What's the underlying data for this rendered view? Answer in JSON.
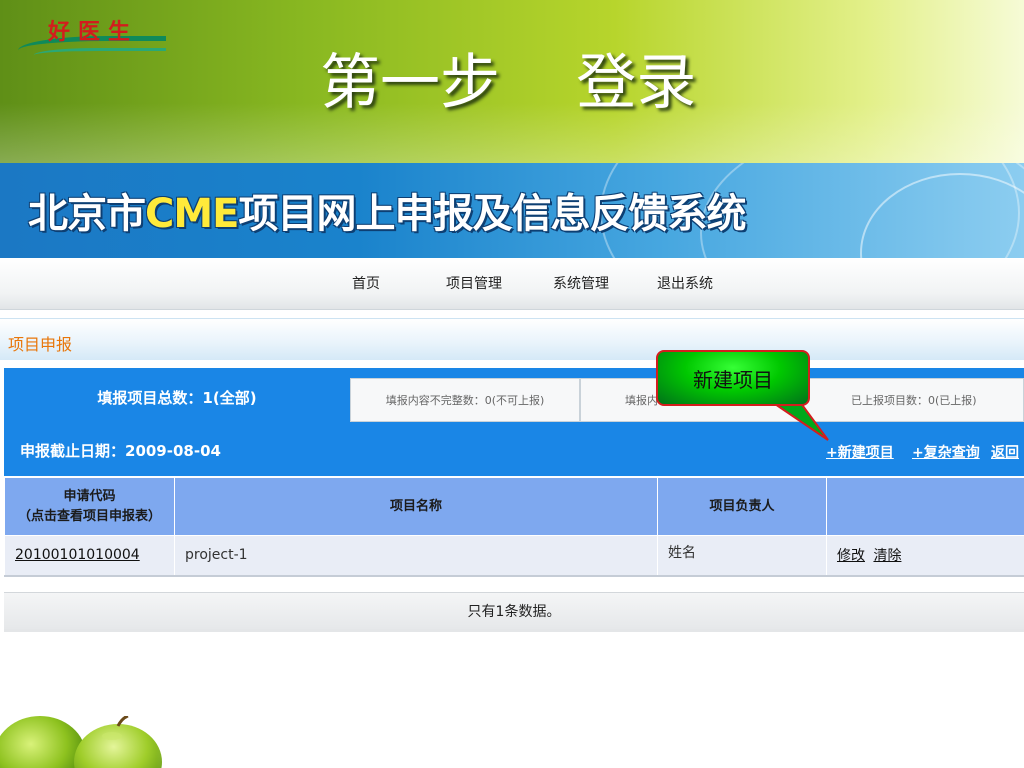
{
  "slide": {
    "title": "第一步    登录",
    "logo_text": "好医生"
  },
  "banner": {
    "title_prefix": "北京市",
    "title_accent": "CME",
    "title_suffix": "项目网上申报及信息反馈系统"
  },
  "nav": {
    "items": [
      "首页",
      "项目管理",
      "系统管理",
      "退出系统"
    ]
  },
  "section": {
    "title": "项目申报"
  },
  "tabs": {
    "active": "填报项目总数：1(全部)",
    "items": [
      "填报内容不完整数：0(不可上报)",
      "填报内",
      "已上报项目数：0(已上报)"
    ]
  },
  "info": {
    "deadline": "申报截止日期：2009-08-04",
    "actions": [
      "+新建项目",
      "+复杂查询",
      "返回"
    ]
  },
  "table": {
    "headers": [
      "申请代码",
      "（点击查看项目申报表）",
      "项目名称",
      "项目负责人",
      ""
    ],
    "rows": [
      {
        "code": "2010010101000​4",
        "name": "project-1",
        "owner": "姓名",
        "edit": "修改",
        "clear": "清除"
      }
    ]
  },
  "footer": {
    "text": "只有1条数据。"
  },
  "callout": {
    "text": "新建项目"
  },
  "colors": {
    "tab_blue": "#1a86e6",
    "header_blue": "#7ea8ef",
    "callout_green": "#00c800",
    "callout_border": "#d41e1e",
    "section_orange": "#e8760a"
  }
}
